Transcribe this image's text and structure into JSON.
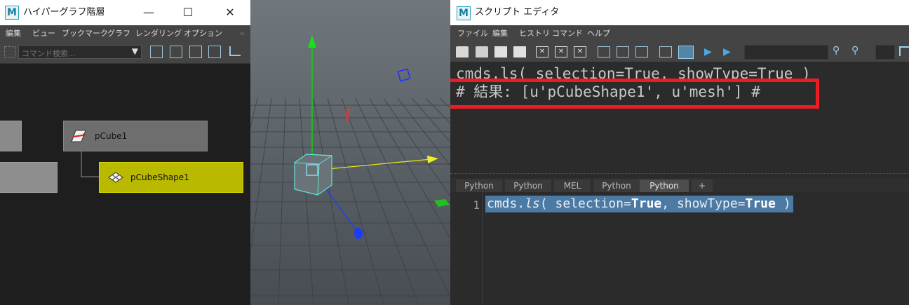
{
  "colors": {
    "title_bar_bg": "#ffffff",
    "menubar_bg": "#444444",
    "hypergraph_bg": "#1e1e1e",
    "node_gray": "#6e6e6e",
    "node_selected": "#b9b900",
    "viewport_bg": "#555d63",
    "highlight_red": "#ec1c24",
    "selection_blue": "#4b7ba4"
  },
  "hypergraph": {
    "title": "ハイパーグラフ階層",
    "app_logo": "M",
    "menus": [
      "編集",
      "ビュー",
      "ブックマーク",
      "グラフ",
      "レンダリング",
      "オプション"
    ],
    "command_search": {
      "placeholder": "コマンド検索..."
    },
    "nodes": {
      "transform": {
        "label": "pCube1",
        "icon": "transform-node-icon"
      },
      "shape": {
        "label": "pCubeShape1",
        "icon": "mesh-shape-icon"
      }
    }
  },
  "viewport": {
    "objects": [
      "move-manipulator",
      "cube"
    ]
  },
  "script_editor": {
    "title": "スクリプト エディタ",
    "app_logo": "M",
    "menus": [
      "ファイル",
      "編集",
      "ヒストリ",
      "コマンド",
      "ヘルプ"
    ],
    "history": {
      "command_line": "cmds.ls( selection=True, showType=True )",
      "result_line": "# 結果: [u'pCubeShape1', u'mesh'] #"
    },
    "tabs": [
      "Python",
      "Python",
      "MEL",
      "Python",
      "Python",
      "+"
    ],
    "active_tab_index": 4,
    "input": {
      "line_number": "1",
      "code": {
        "p1": "cmds.",
        "p2": "ls",
        "p3": "( selection=",
        "p4": "True",
        "p5": ", showType=",
        "p6": "True",
        "p7": " )"
      }
    }
  }
}
